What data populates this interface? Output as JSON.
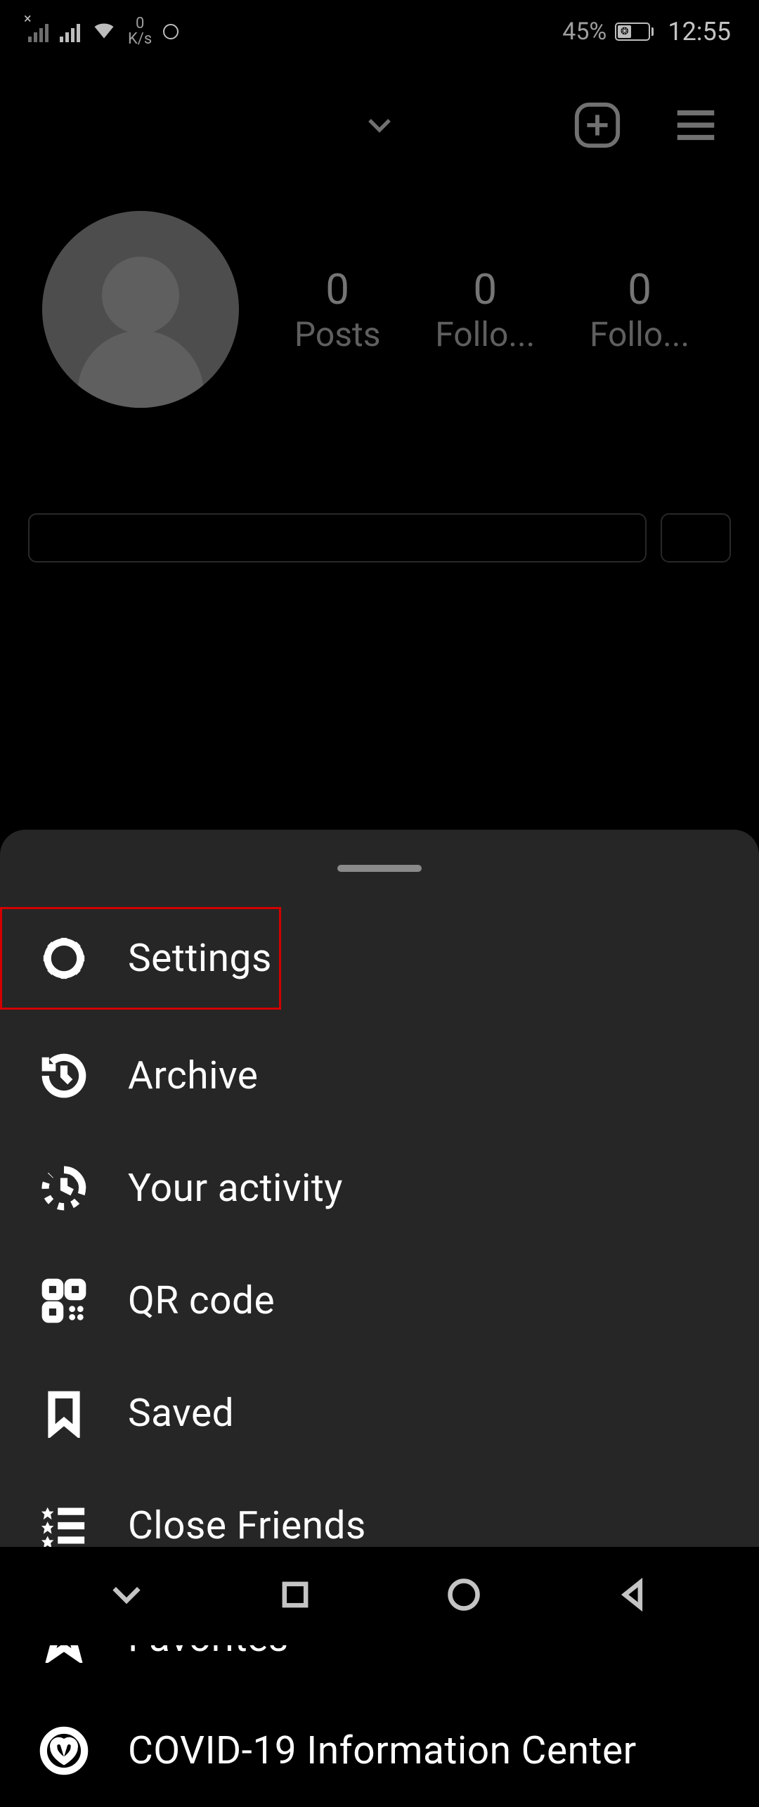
{
  "status_bar": {
    "speed_value": "0",
    "speed_unit": "K/s",
    "battery_pct": "45%",
    "time": "12:55"
  },
  "profile": {
    "stats": [
      {
        "count": "0",
        "label": "Posts"
      },
      {
        "count": "0",
        "label": "Follo..."
      },
      {
        "count": "0",
        "label": "Follo..."
      }
    ]
  },
  "menu": {
    "items": [
      {
        "label": "Settings"
      },
      {
        "label": "Archive"
      },
      {
        "label": "Your activity"
      },
      {
        "label": "QR code"
      },
      {
        "label": "Saved"
      },
      {
        "label": "Close Friends"
      },
      {
        "label": "Favorites"
      },
      {
        "label": "COVID-19 Information Center"
      }
    ]
  },
  "highlight_index": 0
}
